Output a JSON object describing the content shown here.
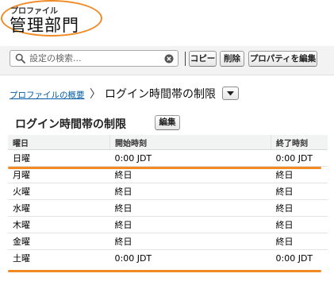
{
  "header": {
    "subtitle": "プロファイル",
    "title": "管理部門"
  },
  "toolbar": {
    "search_placeholder": "設定の検索...",
    "copy_label": "コピー",
    "delete_label": "削除",
    "edit_props_label": "プロパティを編集"
  },
  "breadcrumb": {
    "link": "プロファイルの概要",
    "separator": "〉",
    "current": "ログイン時間帯の制限"
  },
  "section": {
    "title": "ログイン時間帯の制限",
    "edit_label": "編集"
  },
  "table": {
    "headers": {
      "day": "曜日",
      "start": "開始時刻",
      "end": "終了時刻"
    },
    "rows": [
      {
        "day": "日曜",
        "start": "0:00 JDT",
        "end": "0:00 JDT"
      },
      {
        "day": "月曜",
        "start": "終日",
        "end": "終日"
      },
      {
        "day": "火曜",
        "start": "終日",
        "end": "終日"
      },
      {
        "day": "水曜",
        "start": "終日",
        "end": "終日"
      },
      {
        "day": "木曜",
        "start": "終日",
        "end": "終日"
      },
      {
        "day": "金曜",
        "start": "終日",
        "end": "終日"
      },
      {
        "day": "土曜",
        "start": "0:00 JDT",
        "end": "0:00 JDT"
      }
    ]
  },
  "colors": {
    "highlight": "#f08a24",
    "link": "#015ba7"
  }
}
